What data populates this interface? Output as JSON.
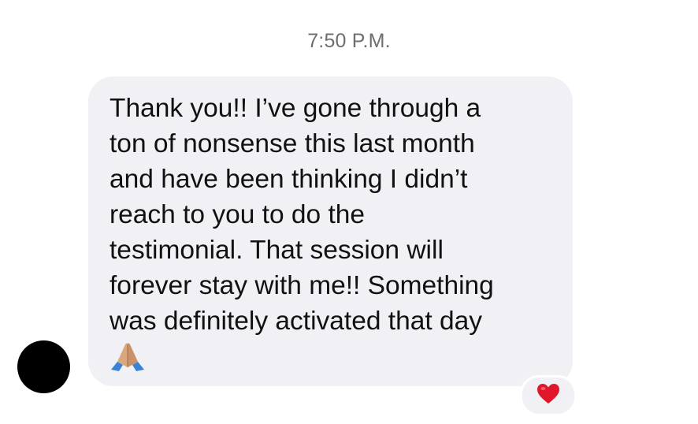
{
  "conversation": {
    "timestamp": "7:50 P.M."
  },
  "message": {
    "text": "Thank you!! I’ve gone through a\nton of nonsense this last month\nand have been thinking I didn’t\nreach to you to do the\ntestimonial. That session will\nforever stay with me!! Something\nwas definitely activated that day",
    "trailing_emoji": "folded-hands-emoji",
    "bubble_color": "#f0f0f5",
    "sender_avatar_color": "#000000"
  },
  "reaction": {
    "icon": "red-heart-icon",
    "color": "#e0162b"
  }
}
